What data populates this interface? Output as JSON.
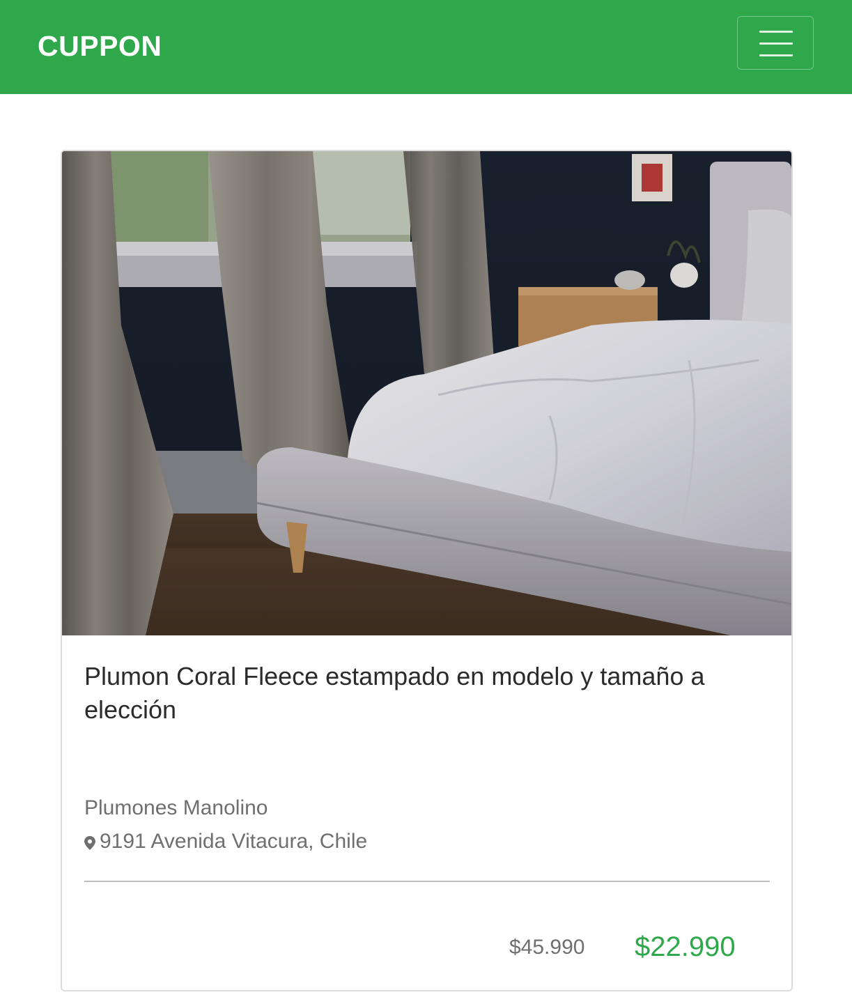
{
  "navbar": {
    "brand": "CUPPON",
    "menu_icon": "hamburger-menu-icon",
    "color": "#2fa84b"
  },
  "deal": {
    "image_alt": "Bedroom with a grey upholstered bed and white duvet",
    "title": "Plumon Coral Fleece estampado en modelo y tamaño a elección",
    "merchant": "Plumones Manolino",
    "location_icon": "map-marker-icon",
    "address": "9191 Avenida Vitacura, Chile",
    "original_price": "$45.990",
    "sale_price": "$22.990",
    "sale_color": "#2fa84b"
  }
}
